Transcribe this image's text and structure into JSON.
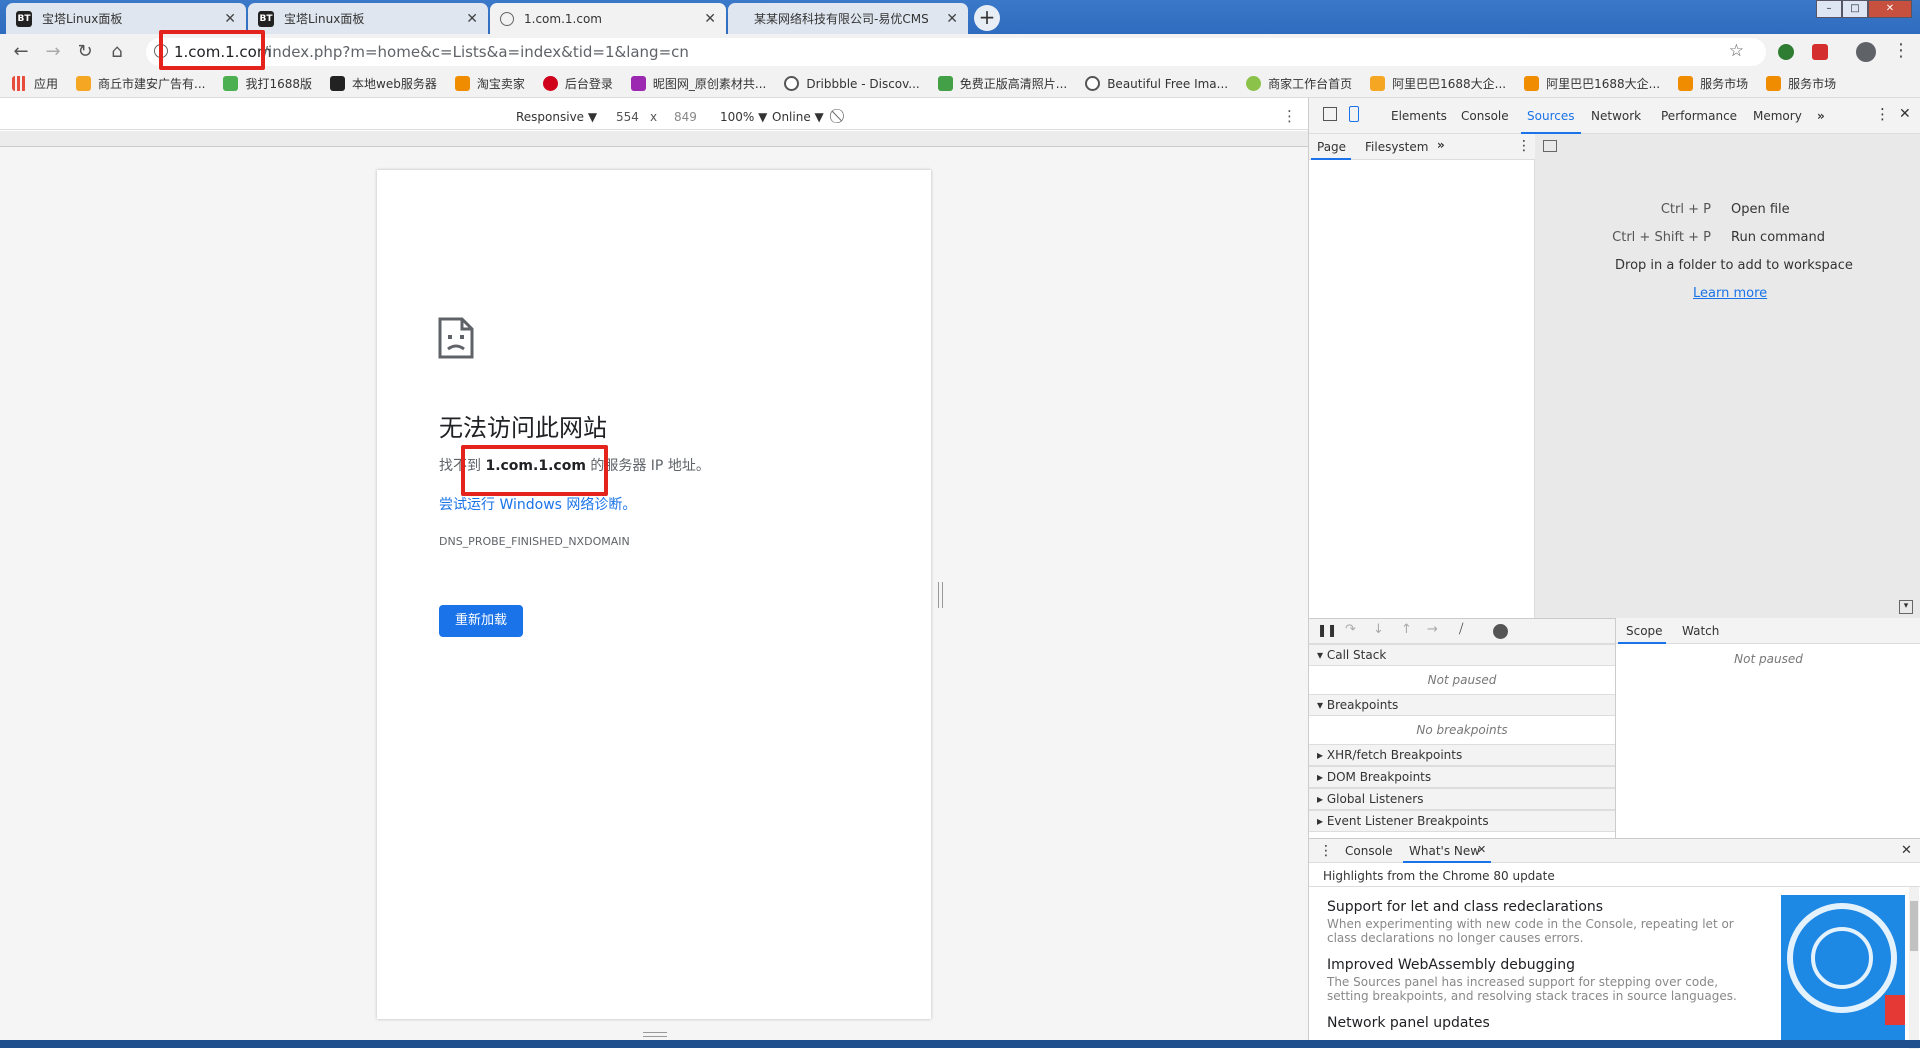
{
  "tabs": [
    {
      "title": "宝塔Linux面板",
      "favicon": "BT"
    },
    {
      "title": "宝塔Linux面板",
      "favicon": "BT"
    },
    {
      "title": "1.com.1.com",
      "favicon": ""
    },
    {
      "title": "某某网络科技有限公司-易优CMS",
      "favicon": ""
    }
  ],
  "address": {
    "host": "1.com.1.com",
    "path": "/index.php?m=home&c=Lists&a=index&tid=1&lang=cn"
  },
  "bookmarks": [
    {
      "label": "应用",
      "color": "#e74c3c"
    },
    {
      "label": "商丘市建安广告有...",
      "color": "#f5a623"
    },
    {
      "label": "我打1688版",
      "color": "#4caf50"
    },
    {
      "label": "本地web服务器",
      "color": "#222222"
    },
    {
      "label": "淘宝卖家",
      "color": "#f08c00"
    },
    {
      "label": "后台登录",
      "color": "#d0021b"
    },
    {
      "label": "昵图网_原创素材共...",
      "color": "#9c27b0"
    },
    {
      "label": "Dribbble - Discov...",
      "color": "#555555"
    },
    {
      "label": "免费正版高清照片...",
      "color": "#43a047"
    },
    {
      "label": "Beautiful Free Ima...",
      "color": "#555555"
    },
    {
      "label": "商家工作台首页",
      "color": "#8bc34a"
    },
    {
      "label": "阿里巴巴1688大企...",
      "color": "#f5a623"
    },
    {
      "label": "阿里巴巴1688大企...",
      "color": "#f08c00"
    },
    {
      "label": "服务市场",
      "color": "#f08c00"
    },
    {
      "label": "服务市场",
      "color": "#f08c00"
    }
  ],
  "device_toolbar": {
    "mode": "Responsive ▼",
    "width": "554",
    "times": "x",
    "height": "849",
    "zoom": "100% ▼",
    "network": "Online ▼"
  },
  "error_page": {
    "title": "无法访问此网站",
    "desc_prefix": "找不到 ",
    "desc_host": "1.com.1.com",
    "desc_suffix": " 的服务器 IP 地址。",
    "link": "尝试运行 Windows 网络诊断。",
    "code": "DNS_PROBE_FINISHED_NXDOMAIN",
    "reload": "重新加载"
  },
  "devtools": {
    "tabs": [
      "Elements",
      "Console",
      "Sources",
      "Network",
      "Performance",
      "Memory"
    ],
    "active_tab": "Sources",
    "subtabs": [
      "Page",
      "Filesystem"
    ],
    "shortcuts": [
      {
        "keys": "Ctrl + P",
        "action": "Open file"
      },
      {
        "keys": "Ctrl + Shift + P",
        "action": "Run command"
      }
    ],
    "drop_hint": "Drop in a folder to add to workspace",
    "learn_more": "Learn more",
    "sections": {
      "call_stack": "Call Stack",
      "not_paused": "Not paused",
      "breakpoints": "Breakpoints",
      "no_breakpoints": "No breakpoints",
      "xhr": "XHR/fetch Breakpoints",
      "dom": "DOM Breakpoints",
      "global": "Global Listeners",
      "event": "Event Listener Breakpoints"
    },
    "scope_tabs": [
      "Scope",
      "Watch"
    ],
    "scope_not_paused": "Not paused",
    "drawer_tabs": [
      "Console",
      "What's New"
    ],
    "drawer_heading": "Highlights from the Chrome 80 update",
    "news": [
      {
        "title": "Support for let and class redeclarations",
        "desc": "When experimenting with new code in the Console, repeating let or class declarations no longer causes errors."
      },
      {
        "title": "Improved WebAssembly debugging",
        "desc": "The Sources panel has increased support for stepping over code, setting breakpoints, and resolving stack traces in source languages."
      },
      {
        "title": "Network panel updates",
        "desc": ""
      }
    ]
  }
}
